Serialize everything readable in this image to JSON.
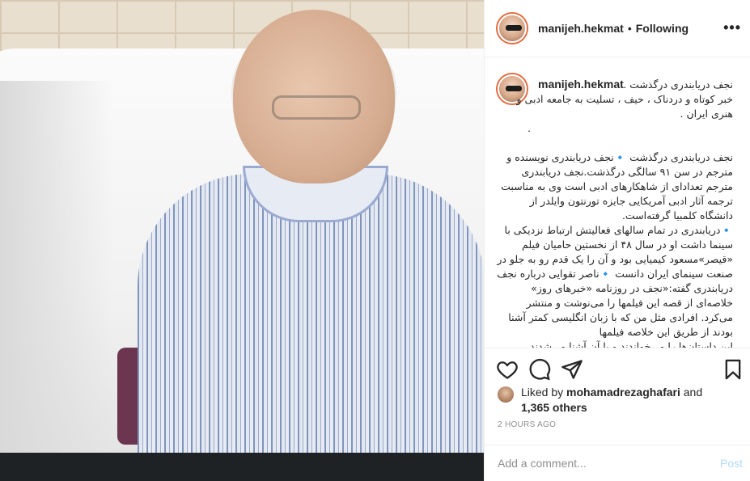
{
  "post": {
    "username": "manijeh.hekmat",
    "separator": "•",
    "follow_status": "Following",
    "more_icon": "more-options-icon"
  },
  "caption": {
    "username": "manijeh.hekmat",
    "line1": "نجف دریابندری درگذشت .",
    "line2": "خبر کوتاه و دردناک ، حیف ، تسلیت به جامعه ادبی و هنری ایران .",
    "line3": ".",
    "paragraph1": "نجف دریابندری درگذشت 🔹نجف دریابندری نویسنده و مترجم در سن ۹۱ سالگی درگذشت.نجف دریابندری مترجم تعدادای از شاهکارهای ادبی است وی به مناسبت ترجمه آثار ادبی آمریکایی جایزه تورنتون وایلدر از دانشگاه کلمبیا گرفته‌است.",
    "paragraph2": "🔹دریابندری در تمام سالهای فعالیتش ارتباط نزدیکی با سینما داشت او در سال ۴۸ از نخستین حامیان فیلم «قیصر»مسعود کیمیایی بود و آن را یک قدم رو به جلو در صنعت سینمای ایران دانست 🔹ناصر تقوایی درباره نجف دریابندری گفته:«نجف در روزنامه «خبرهای روز» خلاصه‌ای از قصه این فیلمها را می‌نوشت و منتشر می‌کرد. افرادی مثل من که با زبان انگلیسی کمتر آشنا بودند از طریق این خلاصه فیلمها",
    "paragraph3": "این داستان‌ها را می‌خواندند و با آن آشنا می‌شدند"
  },
  "actions": {
    "like_icon": "heart-icon",
    "comment_icon": "comment-icon",
    "share_icon": "share-icon",
    "save_icon": "bookmark-icon"
  },
  "likes": {
    "prefix": "Liked by",
    "user": "mohamadrezaghafari",
    "and": "and",
    "others": "1,365 others"
  },
  "timestamp": "2 HOURS AGO",
  "comment": {
    "placeholder": "Add a comment...",
    "post_label": "Post"
  },
  "colors": {
    "accent_blue": "#3897f0",
    "post_disabled": "#b3dbff",
    "story_ring": "#e6683c"
  }
}
